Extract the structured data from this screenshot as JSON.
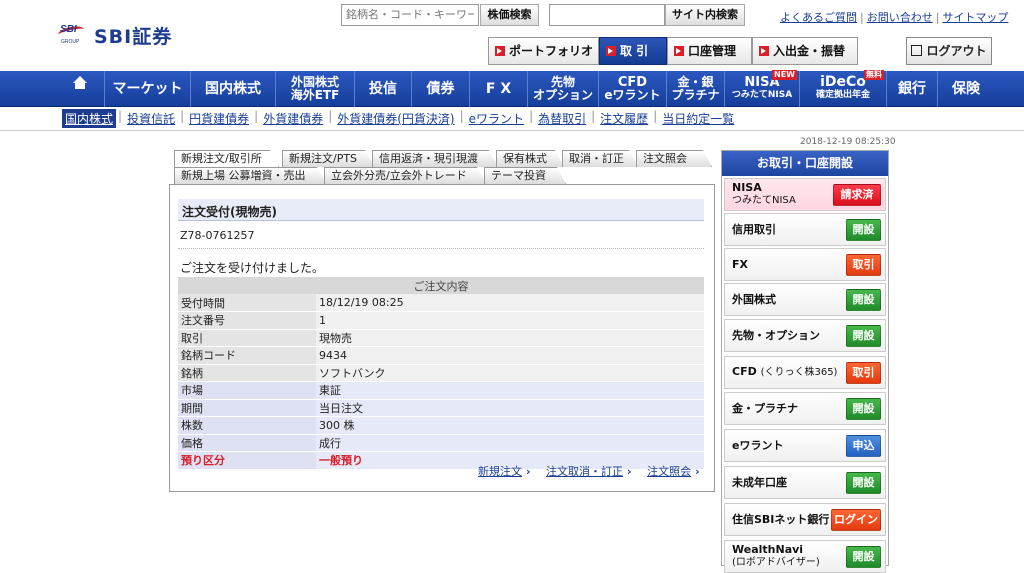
{
  "header": {
    "logo_text": "SBI証券",
    "logo_mark": "SBI",
    "logo_group": "GROUP",
    "search_placeholder": "銘柄名・コード・キーワード",
    "stock_search_btn": "株価検索",
    "site_search_btn": "サイト内検索",
    "links": [
      "よくあるご質問",
      "お問い合わせ",
      "サイトマップ"
    ],
    "buttons": [
      "ポートフォリオ",
      "取 引",
      "口座管理",
      "入出金・振替"
    ],
    "logout": "ログアウト"
  },
  "nav": {
    "items": [
      {
        "label": "マーケット"
      },
      {
        "label": "国内株式"
      },
      {
        "label": "外国株式",
        "sub": "海外ETF"
      },
      {
        "label": "投信"
      },
      {
        "label": "債券"
      },
      {
        "label": "F X"
      },
      {
        "label": "先物",
        "sub": "オプション"
      },
      {
        "label": "CFD",
        "sub": "eワラント"
      },
      {
        "label": "金・銀",
        "sub": "プラチナ"
      },
      {
        "label": "NISA",
        "sub": "つみたてNISA",
        "badge": "NEW"
      },
      {
        "label": "iDeCo",
        "sub": "確定拠出年金",
        "badge": "無料"
      },
      {
        "label": "銀行"
      },
      {
        "label": "保険"
      }
    ]
  },
  "subnav": [
    "国内株式",
    "投資信託",
    "円貨建債券",
    "外貨建債券",
    "外貨建債券(円貨決済)",
    "eワラント",
    "為替取引",
    "注文履歴",
    "当日約定一覧"
  ],
  "datetime": "2018-12-19 08:25:30",
  "tabs_row1": [
    "新規注文/取引所",
    "新規注文/PTS",
    "信用返済・現引現渡",
    "保有株式",
    "取消・訂正",
    "注文照会"
  ],
  "tabs_row2": [
    "新規上場 公募増資・売出",
    "立会外分売/立会外トレード",
    "テーマ投資"
  ],
  "order": {
    "title": "注文受付(現物売)",
    "id": "Z78-0761257",
    "message": "ご注文を受け付けました。",
    "table_header": "ご注文内容",
    "rows": [
      {
        "k": "受付時間",
        "v": "18/12/19 08:25"
      },
      {
        "k": "注文番号",
        "v": "1"
      },
      {
        "k": "取引",
        "v": "現物売"
      },
      {
        "k": "銘柄コード",
        "v": "9434"
      },
      {
        "k": "銘柄",
        "v": "ソフトバンク"
      },
      {
        "k": "市場",
        "v": "東証"
      },
      {
        "k": "期間",
        "v": "当日注文"
      },
      {
        "k": "株数",
        "v": "300 株"
      },
      {
        "k": "価格",
        "v": "成行"
      },
      {
        "k": "預り区分",
        "v": "一般預り"
      }
    ],
    "links": [
      "新規注文",
      "注文取消・訂正",
      "注文照会"
    ]
  },
  "side": {
    "title": "お取引・口座開設",
    "rows": [
      {
        "label": "NISA",
        "sub": "つみたてNISA",
        "btn": "請求済"
      },
      {
        "label": "信用取引",
        "btn": "開設"
      },
      {
        "label": "FX",
        "btn": "取引"
      },
      {
        "label": "外国株式",
        "btn": "開設"
      },
      {
        "label": "先物・オプション",
        "btn": "開設"
      },
      {
        "label": "CFD",
        "sub": "(くりっく株365)",
        "btn": "取引"
      },
      {
        "label": "金・プラチナ",
        "btn": "開設"
      },
      {
        "label": "eワラント",
        "btn": "申込"
      },
      {
        "label": "未成年口座",
        "btn": "開設"
      },
      {
        "label": "住信SBIネット銀行",
        "btn": "ログイン"
      },
      {
        "label": "WealthNavi",
        "sub": "(ロボアドバイザー)",
        "btn": "開設"
      }
    ]
  },
  "colors": {
    "brand": "#1d3b8f",
    "accent_red": "#d8202b",
    "nav_blue": "#163f9a",
    "open_green": "#1f8a2a"
  }
}
